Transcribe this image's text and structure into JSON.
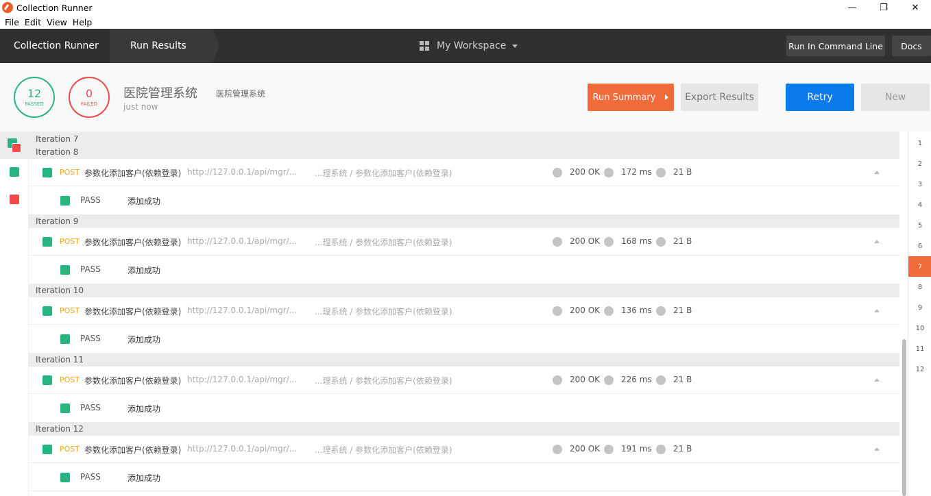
{
  "window": {
    "title": "Collection Runner",
    "minimize": "—",
    "maximize": "❐",
    "close": "✕"
  },
  "menu": [
    "File",
    "Edit",
    "View",
    "Help"
  ],
  "header": {
    "crumbs": [
      "Collection Runner",
      "Run Results"
    ],
    "workspace": "My Workspace",
    "run_cli": "Run In Command Line",
    "docs": "Docs"
  },
  "summary": {
    "passed_count": "12",
    "passed_label": "PASSED",
    "failed_count": "0",
    "failed_label": "FAILED",
    "collection_name": "医院管理系统",
    "collection_sub": "医院管理系统",
    "time": "just now",
    "run_summary": "Run Summary",
    "export": "Export Results",
    "retry": "Retry",
    "new": "New"
  },
  "colors": {
    "accent": "#f26b3a",
    "pass": "#26b47f",
    "fail": "#ed4b48",
    "primary": "#097bed"
  },
  "results": {
    "top_iterations": [
      "Iteration 7",
      "Iteration 8"
    ],
    "iterations": [
      {
        "label": "Iteration 8",
        "method": "POST",
        "name": "参数化添加客户(依赖登录)",
        "url": "http://127.0.0.1/api/mgr/...",
        "path": "...理系统 / 参数化添加客户(依赖登录)",
        "status": "200 OK",
        "time": "172 ms",
        "size": "21 B",
        "test": "PASS",
        "message": "添加成功"
      },
      {
        "label": "Iteration 9",
        "method": "POST",
        "name": "参数化添加客户(依赖登录)",
        "url": "http://127.0.0.1/api/mgr/...",
        "path": "...理系统 / 参数化添加客户(依赖登录)",
        "status": "200 OK",
        "time": "168 ms",
        "size": "21 B",
        "test": "PASS",
        "message": "添加成功"
      },
      {
        "label": "Iteration 10",
        "method": "POST",
        "name": "参数化添加客户(依赖登录)",
        "url": "http://127.0.0.1/api/mgr/...",
        "path": "...理系统 / 参数化添加客户(依赖登录)",
        "status": "200 OK",
        "time": "136 ms",
        "size": "21 B",
        "test": "PASS",
        "message": "添加成功"
      },
      {
        "label": "Iteration 11",
        "method": "POST",
        "name": "参数化添加客户(依赖登录)",
        "url": "http://127.0.0.1/api/mgr/...",
        "path": "...理系统 / 参数化添加客户(依赖登录)",
        "status": "200 OK",
        "time": "226 ms",
        "size": "21 B",
        "test": "PASS",
        "message": "添加成功"
      },
      {
        "label": "Iteration 12",
        "method": "POST",
        "name": "参数化添加客户(依赖登录)",
        "url": "http://127.0.0.1/api/mgr/...",
        "path": "...理系统 / 参数化添加客户(依赖登录)",
        "status": "200 OK",
        "time": "191 ms",
        "size": "21 B",
        "test": "PASS",
        "message": "添加成功"
      }
    ]
  },
  "iteration_index": [
    "1",
    "2",
    "3",
    "4",
    "5",
    "6",
    "7",
    "8",
    "9",
    "10",
    "11",
    "12"
  ],
  "active_iteration": "7"
}
